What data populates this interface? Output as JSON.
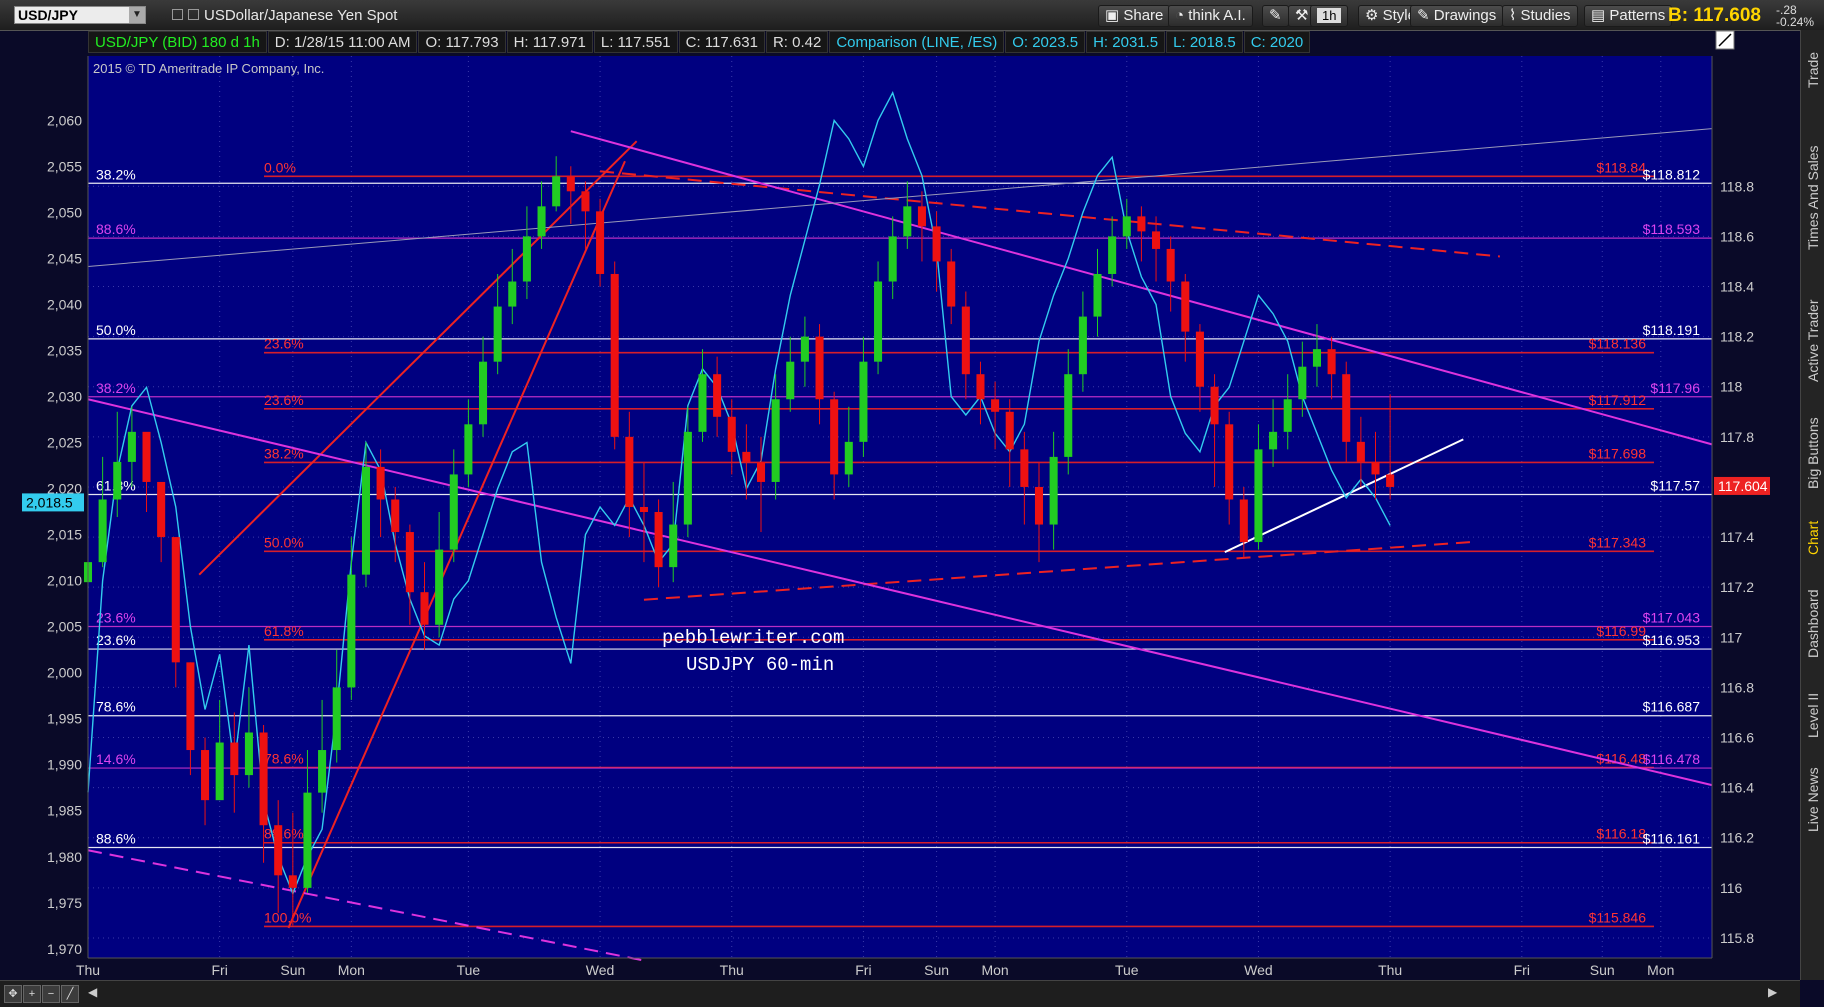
{
  "window": {
    "symbol": "USD/JPY",
    "symbol_desc": "USDollar/Japanese Yen Spot",
    "buttons": [
      "Share",
      "think A.I.",
      "1h",
      "Style",
      "Drawings",
      "Studies",
      "Patterns"
    ],
    "bid": "B: 117.608",
    "change_abs": "-.28",
    "change_pct": "-0.24%"
  },
  "infobar": [
    "USD/JPY (BID) 180 d 1h",
    "D: 1/28/15 11:00 AM",
    "O: 117.793",
    "H: 117.971",
    "L: 117.551",
    "C: 117.631",
    "R: 0.42",
    "Comparison (LINE, /ES)",
    "O: 2023.5",
    "H: 2031.5",
    "L: 2018.5",
    "C: 2020"
  ],
  "copyright": "2015 © TD Ameritrade IP Company, Inc.",
  "sidebar": [
    "Trade",
    "Times And Sales",
    "Active Trader",
    "Big Buttons",
    "Chart",
    "Dashboard",
    "Level II",
    "Live News"
  ],
  "colors": {
    "background": "#0a0a28",
    "plot_bg": "#000080",
    "up_candle": "#22cc22",
    "down_candle": "#ee1111",
    "comparison_line": "#33ccee",
    "fib_red": "#ee2222",
    "fib_magenta": "#cc33cc",
    "fib_white": "#ffffff",
    "price_tag": "#ee2222"
  },
  "chart_data": {
    "type": "line",
    "title": "",
    "xlabel": "",
    "ylabel": "",
    "watermark": [
      "pebblewriter.com",
      "USDJPY 60-min"
    ],
    "x_ticks": [
      "Thu",
      "Fri",
      "Sun",
      "Mon",
      "Tue",
      "Wed",
      "Thu",
      "Fri",
      "Sun",
      "Mon",
      "Tue",
      "Wed",
      "Thu",
      "Fri",
      "Sun",
      "Mon"
    ],
    "x_tick_index": [
      0,
      9,
      14,
      18,
      26,
      35,
      44,
      53,
      58,
      62,
      71,
      80,
      89,
      98,
      103.5,
      107.5
    ],
    "x_range": [
      0,
      111
    ],
    "y_right": {
      "range": [
        115.72,
        119.32
      ],
      "ticks": [
        "115.8",
        "116",
        "116.2",
        "116.4",
        "116.6",
        "116.8",
        "117",
        "117.2",
        "117.4",
        "117.6",
        "117.8",
        "118",
        "118.2",
        "118.4",
        "118.6",
        "118.8"
      ]
    },
    "y_left": {
      "range": [
        1969,
        2067
      ],
      "ticks": [
        "1,970",
        "1,975",
        "1,980",
        "1,985",
        "1,990",
        "1,995",
        "2,000",
        "2,005",
        "2,010",
        "2,015",
        "2,020",
        "2,025",
        "2,030",
        "2,035",
        "2,040",
        "2,045",
        "2,050",
        "2,055",
        "2,060"
      ]
    },
    "current_price_tag": "117.604",
    "comparison_tag": "2,018.5",
    "series": [
      {
        "name": "USD/JPY",
        "close": [
          117.3,
          117.55,
          117.7,
          117.82,
          117.62,
          117.4,
          116.9,
          116.55,
          116.35,
          116.58,
          116.45,
          116.62,
          116.25,
          116.05,
          116.0,
          116.38,
          116.55,
          116.8,
          117.25,
          117.68,
          117.55,
          117.42,
          117.18,
          117.05,
          117.35,
          117.65,
          117.85,
          118.1,
          118.32,
          118.42,
          118.6,
          118.72,
          118.84,
          118.78,
          118.7,
          118.45,
          117.8,
          117.52,
          117.5,
          117.28,
          117.45,
          117.82,
          118.05,
          117.88,
          117.74,
          117.7,
          117.62,
          117.95,
          118.1,
          118.2,
          117.95,
          117.65,
          117.78,
          118.1,
          118.42,
          118.6,
          118.72,
          118.64,
          118.5,
          118.32,
          118.05,
          117.95,
          117.9,
          117.75,
          117.6,
          117.45,
          117.72,
          118.05,
          118.28,
          118.45,
          118.6,
          118.68,
          118.62,
          118.55,
          118.42,
          118.22,
          118.0,
          117.85,
          117.55,
          117.38,
          117.75,
          117.82,
          117.95,
          118.08,
          118.15,
          118.05,
          117.78,
          117.7,
          117.65,
          117.6
        ],
        "high": [
          117.6,
          117.72,
          117.9,
          117.92,
          117.72,
          117.6,
          117.4,
          116.9,
          116.6,
          116.75,
          116.7,
          116.8,
          116.65,
          116.35,
          116.3,
          116.55,
          116.75,
          116.95,
          117.4,
          117.78,
          117.75,
          117.6,
          117.45,
          117.3,
          117.5,
          117.75,
          117.95,
          118.2,
          118.45,
          118.55,
          118.72,
          118.82,
          118.92,
          118.88,
          118.82,
          118.75,
          118.5,
          117.9,
          117.7,
          117.55,
          117.62,
          117.92,
          118.15,
          118.12,
          117.95,
          117.85,
          117.8,
          118.05,
          118.2,
          118.28,
          118.25,
          117.98,
          117.92,
          118.2,
          118.5,
          118.68,
          118.82,
          118.78,
          118.7,
          118.55,
          118.38,
          118.1,
          118.02,
          117.95,
          117.82,
          117.7,
          117.82,
          118.15,
          118.38,
          118.55,
          118.68,
          118.75,
          118.72,
          118.68,
          118.6,
          118.45,
          118.25,
          118.05,
          117.9,
          117.6,
          117.85,
          117.95,
          118.05,
          118.18,
          118.25,
          118.2,
          118.1,
          117.88,
          117.82,
          117.97
        ],
        "low": [
          117.2,
          117.28,
          117.48,
          117.6,
          117.5,
          117.3,
          116.8,
          116.45,
          116.25,
          116.35,
          116.3,
          116.4,
          116.1,
          115.9,
          115.85,
          115.98,
          116.3,
          116.5,
          116.75,
          117.2,
          117.4,
          117.3,
          117.05,
          116.95,
          117.0,
          117.3,
          117.6,
          117.8,
          118.05,
          118.25,
          118.35,
          118.55,
          118.7,
          118.65,
          118.55,
          118.4,
          117.75,
          117.4,
          117.3,
          117.2,
          117.22,
          117.4,
          117.78,
          117.8,
          117.65,
          117.55,
          117.42,
          117.55,
          117.9,
          118.0,
          117.85,
          117.55,
          117.6,
          117.72,
          118.05,
          118.35,
          118.55,
          118.5,
          118.38,
          118.25,
          117.95,
          117.85,
          117.75,
          117.6,
          117.45,
          117.3,
          117.35,
          117.65,
          117.98,
          118.2,
          118.4,
          118.55,
          118.5,
          118.42,
          118.3,
          118.1,
          117.9,
          117.6,
          117.45,
          117.32,
          117.35,
          117.68,
          117.75,
          117.88,
          118.0,
          117.95,
          117.7,
          117.6,
          117.55,
          117.55
        ]
      },
      {
        "name": "/ES",
        "values": [
          1987,
          2010,
          2022,
          2029,
          2031,
          2025,
          2018,
          2005,
          1996,
          2002,
          1990,
          2003,
          1986,
          1980,
          1976,
          1980,
          1983,
          1996,
          2012,
          2025,
          2022,
          2014,
          2008,
          2004,
          2003,
          2008,
          2010,
          2015,
          2020,
          2024,
          2025,
          2012,
          2006,
          2001,
          2015,
          2018,
          2016,
          2019,
          2016,
          2012,
          2014,
          2029,
          2033,
          2031,
          2027,
          2020,
          2023,
          2033,
          2041,
          2047,
          2053,
          2060,
          2058,
          2055,
          2060,
          2063,
          2058,
          2054,
          2046,
          2030,
          2028,
          2030,
          2026,
          2024,
          2027,
          2036,
          2041,
          2045,
          2050,
          2054,
          2056,
          2048,
          2043,
          2040,
          2030,
          2026,
          2024,
          2029,
          2031,
          2036,
          2041,
          2039,
          2036,
          2030,
          2026,
          2022,
          2019,
          2021,
          2019,
          2016
        ]
      }
    ],
    "fib_levels": [
      {
        "price": 118.84,
        "label_left": "0.0%",
        "label_right": "$118.84",
        "set": "red"
      },
      {
        "price": 118.812,
        "label_left": "38.2%",
        "label_right": "$118.812",
        "set": "white"
      },
      {
        "price": 118.593,
        "label_left": "88.6%",
        "label_right": "$118.593",
        "set": "magenta"
      },
      {
        "price": 118.191,
        "label_left": "50.0%",
        "label_right": "$118.191",
        "set": "white"
      },
      {
        "price": 118.136,
        "label_left": "23.6%",
        "label_right": "$118.136",
        "set": "red"
      },
      {
        "price": 117.96,
        "label_left": "38.2%",
        "label_right": "$117.96",
        "set": "magenta"
      },
      {
        "price": 117.912,
        "label_left": "23.6%",
        "label_right": "$117.912",
        "set": "red"
      },
      {
        "price": 117.698,
        "label_left": "38.2%",
        "label_right": "$117.698",
        "set": "red"
      },
      {
        "price": 117.57,
        "label_left": "61.8%",
        "label_right": "$117.57",
        "set": "white"
      },
      {
        "price": 117.343,
        "label_left": "50.0%",
        "label_right": "$117.343",
        "set": "red"
      },
      {
        "price": 117.043,
        "label_left": "23.6%",
        "label_right": "$117.043",
        "set": "magenta"
      },
      {
        "price": 116.99,
        "label_left": "61.8%",
        "label_right": "$116.99",
        "set": "red"
      },
      {
        "price": 116.953,
        "label_left": "23.6%",
        "label_right": "$116.953",
        "set": "white"
      },
      {
        "price": 116.687,
        "label_left": "78.6%",
        "label_right": "$116.687",
        "set": "white"
      },
      {
        "price": 116.48,
        "label_left": "78.6%",
        "label_right": "$116.48",
        "set": "red"
      },
      {
        "price": 116.478,
        "label_left": "14.6%",
        "label_right": "$116.478",
        "set": "magenta"
      },
      {
        "price": 116.18,
        "label_left": "88.6%",
        "label_right": "$116.18",
        "set": "red"
      },
      {
        "price": 116.161,
        "label_left": "88.6%",
        "label_right": "$116.161",
        "set": "white"
      },
      {
        "price": 115.846,
        "label_left": "100.0%",
        "label_right": "$115.846",
        "set": "red"
      }
    ],
    "trendlines": [
      {
        "from": [
          13.7,
          115.84
        ],
        "to": [
          36.7,
          118.9
        ],
        "color": "red",
        "style": "solid"
      },
      {
        "from": [
          7.6,
          117.25
        ],
        "to": [
          37.5,
          118.98
        ],
        "color": "red",
        "style": "solid"
      },
      {
        "from": [
          35.0,
          118.86
        ],
        "to": [
          96.5,
          118.52
        ],
        "color": "red",
        "style": "dashed"
      },
      {
        "from": [
          38.0,
          117.15
        ],
        "to": [
          94.5,
          117.38
        ],
        "color": "red",
        "style": "dashed"
      },
      {
        "from": [
          33.0,
          119.02
        ],
        "to": [
          111.0,
          117.77
        ],
        "color": "magenta",
        "style": "solid"
      },
      {
        "from": [
          0,
          117.95
        ],
        "to": [
          111.0,
          116.41
        ],
        "color": "magenta",
        "style": "solid"
      },
      {
        "from": [
          0,
          116.15
        ],
        "to": [
          38.0,
          115.71
        ],
        "color": "magenta",
        "style": "dashed"
      },
      {
        "from": [
          0,
          118.48
        ],
        "to": [
          111.0,
          119.03
        ],
        "color": "gray",
        "style": "solid"
      },
      {
        "from": [
          77.7,
          117.34
        ],
        "to": [
          94.0,
          117.79
        ],
        "color": "white",
        "style": "solid"
      }
    ]
  }
}
